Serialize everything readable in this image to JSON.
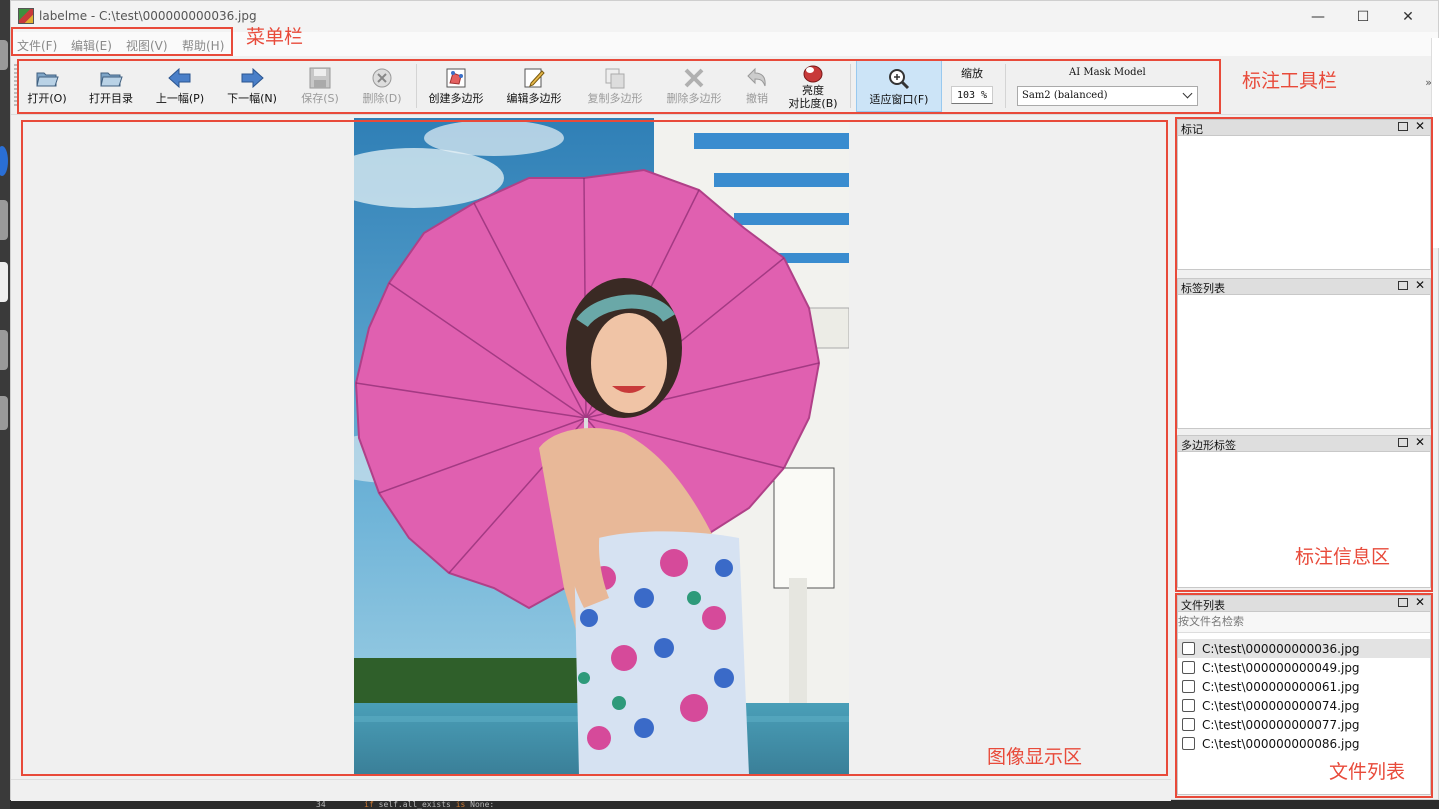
{
  "window": {
    "title": "labelme - C:\\test\\000000000036.jpg",
    "minimize_glyph": "—",
    "maximize_glyph": "☐",
    "close_glyph": "✕"
  },
  "menu": [
    "文件(F)",
    "编辑(E)",
    "视图(V)",
    "帮助(H)"
  ],
  "toolbar": {
    "open": "打开(O)",
    "open_dir": "打开目录",
    "prev": "上一幅(P)",
    "next": "下一幅(N)",
    "save": "保存(S)",
    "delete": "删除(D)",
    "create_polygon": "创建多边形",
    "edit_polygon": "编辑多边形",
    "copy_polygon": "复制多边形",
    "delete_polygon": "删除多边形",
    "undo": "撤销",
    "brightness_line1": "亮度",
    "brightness_line2": "对比度(B)",
    "fit_window": "适应窗口(F)",
    "zoom_label": "缩放",
    "zoom_value": "103 %",
    "ai_model_label": "AI Mask Model",
    "ai_model_value": "Sam2 (balanced)",
    "overflow": "»"
  },
  "docks": {
    "flags": "标记",
    "label_list": "标签列表",
    "polygon_labels": "多边形标签",
    "file_list": "文件列表",
    "search_placeholder": "按文件名检索",
    "files": [
      "C:\\test\\000000000036.jpg",
      "C:\\test\\000000000049.jpg",
      "C:\\test\\000000000061.jpg",
      "C:\\test\\000000000074.jpg",
      "C:\\test\\000000000077.jpg",
      "C:\\test\\000000000086.jpg"
    ],
    "selected_file_index": 0
  },
  "annotations": {
    "menubar": "菜单栏",
    "toolbar": "标注工具栏",
    "image_area": "图像显示区",
    "info_area": "标注信息区",
    "file_list": "文件列表",
    "color": "#e84a3a"
  },
  "background_code": {
    "line_no": "34",
    "keyword_if": "if",
    "text": " self.all_exists ",
    "keyword_is": "is",
    "tail": " None:"
  }
}
